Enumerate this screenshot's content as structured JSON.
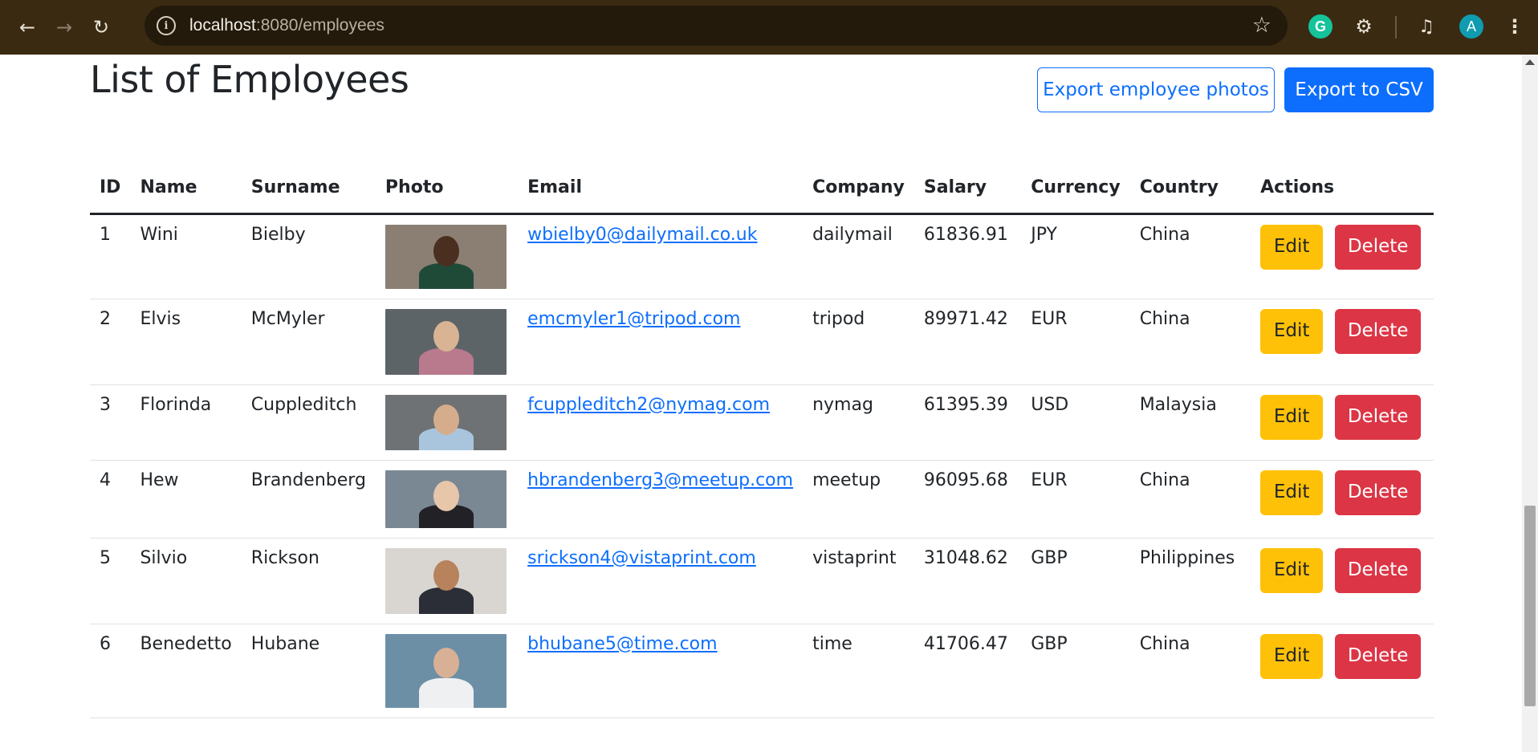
{
  "browser": {
    "url_host": "localhost",
    "url_rest": ":8080/employees",
    "avatar_letter": "A",
    "grammarly_letter": "G"
  },
  "page": {
    "title": "List of Employees",
    "export_photos_label": "Export employee photos",
    "export_csv_label": "Export to CSV"
  },
  "table": {
    "headers": [
      "ID",
      "Name",
      "Surname",
      "Photo",
      "Email",
      "Company",
      "Salary",
      "Currency",
      "Country",
      "Actions"
    ],
    "edit_label": "Edit",
    "delete_label": "Delete",
    "rows": [
      {
        "id": "1",
        "name": "Wini",
        "surname": "Bielby",
        "email": "wbielby0@dailymail.co.uk",
        "company": "dailymail",
        "salary": "61836.91",
        "currency": "JPY",
        "country": "China",
        "photo_bg": "#8a7f72",
        "skin": "#4a2e20",
        "shirt": "#1f4a38"
      },
      {
        "id": "2",
        "name": "Elvis",
        "surname": "McMyler",
        "email": "emcmyler1@tripod.com",
        "company": "tripod",
        "salary": "89971.42",
        "currency": "EUR",
        "country": "China",
        "photo_bg": "#5d6468",
        "skin": "#d9b494",
        "shirt": "#b97a8e"
      },
      {
        "id": "3",
        "name": "Florinda",
        "surname": "Cuppleditch",
        "email": "fcuppleditch2@nymag.com",
        "company": "nymag",
        "salary": "61395.39",
        "currency": "USD",
        "country": "Malaysia",
        "photo_bg": "#6e7274",
        "skin": "#d6ad8c",
        "shirt": "#a9c4dd"
      },
      {
        "id": "4",
        "name": "Hew",
        "surname": "Brandenberg",
        "email": "hbrandenberg3@meetup.com",
        "company": "meetup",
        "salary": "96095.68",
        "currency": "EUR",
        "country": "China",
        "photo_bg": "#7a8894",
        "skin": "#e8c6aa",
        "shirt": "#222226"
      },
      {
        "id": "5",
        "name": "Silvio",
        "surname": "Rickson",
        "email": "srickson4@vistaprint.com",
        "company": "vistaprint",
        "salary": "31048.62",
        "currency": "GBP",
        "country": "Philippines",
        "photo_bg": "#d9d6d1",
        "skin": "#b7825c",
        "shirt": "#2b2e36"
      },
      {
        "id": "6",
        "name": "Benedetto",
        "surname": "Hubane",
        "email": "bhubane5@time.com",
        "company": "time",
        "salary": "41706.47",
        "currency": "GBP",
        "country": "China",
        "photo_bg": "#6d8fa6",
        "skin": "#d8b095",
        "shirt": "#eef0f2"
      }
    ]
  }
}
